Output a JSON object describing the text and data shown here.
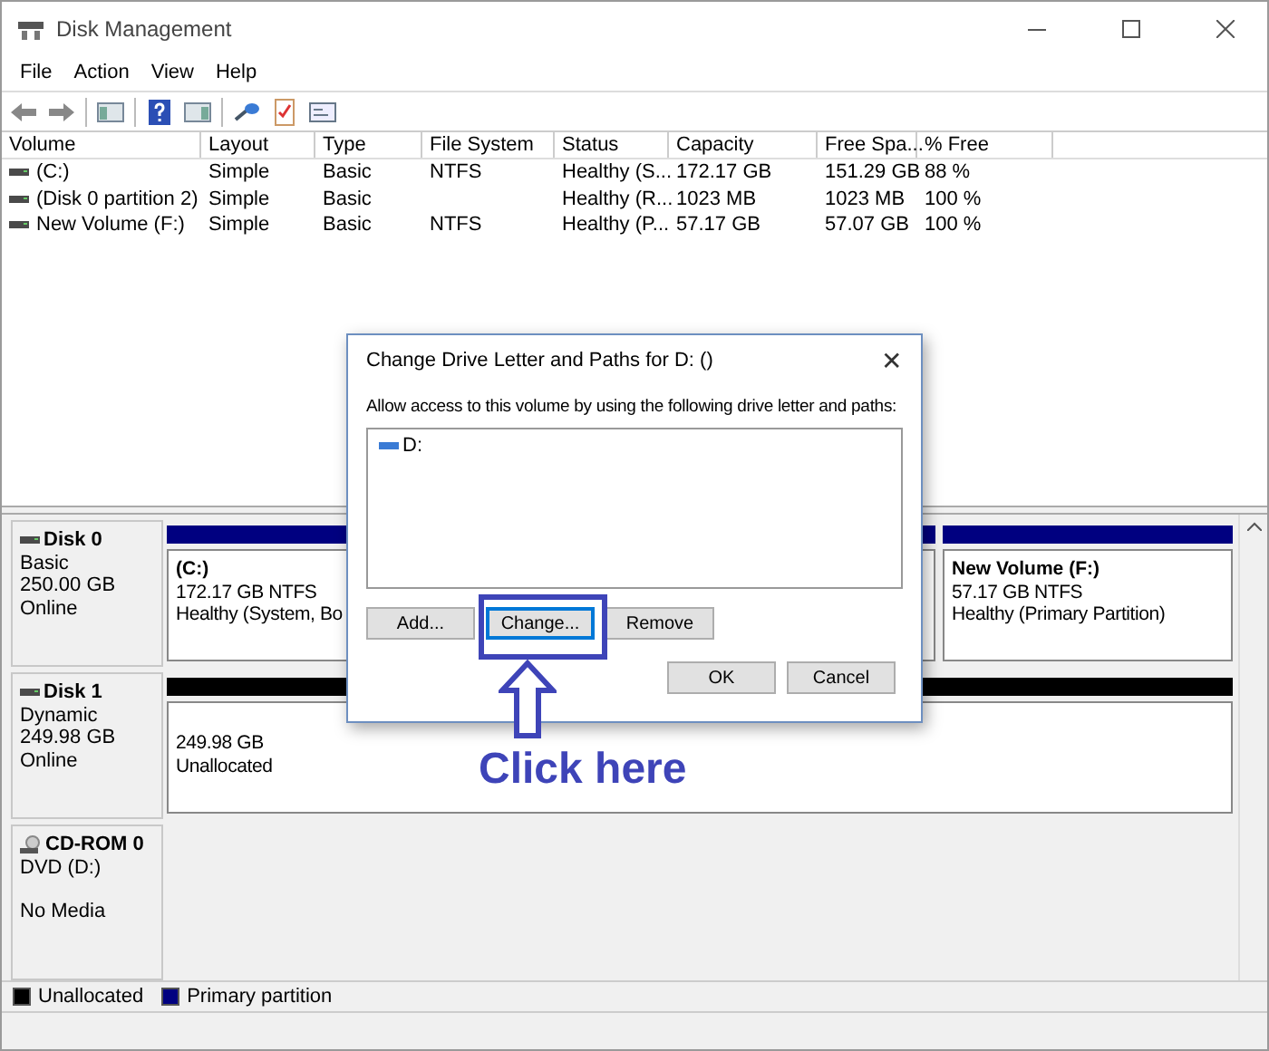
{
  "window": {
    "title": "Disk Management"
  },
  "menu": [
    "File",
    "Action",
    "View",
    "Help"
  ],
  "volumes": {
    "columns": [
      "Volume",
      "Layout",
      "Type",
      "File System",
      "Status",
      "Capacity",
      "Free Spa...",
      "% Free"
    ],
    "rows": [
      [
        "(C:)",
        "Simple",
        "Basic",
        "NTFS",
        "Healthy (S...",
        "172.17 GB",
        "151.29 GB",
        "88 %"
      ],
      [
        "(Disk 0 partition 2)",
        "Simple",
        "Basic",
        "",
        "Healthy (R...",
        "1023 MB",
        "1023 MB",
        "100 %"
      ],
      [
        "New Volume (F:)",
        "Simple",
        "Basic",
        "NTFS",
        "Healthy (P...",
        "57.17 GB",
        "57.07 GB",
        "100 %"
      ]
    ]
  },
  "disks": [
    {
      "kind": "disk",
      "name": "Disk 0",
      "lines": [
        "Basic",
        "250.00 GB",
        "Online"
      ],
      "partitions": [
        {
          "kind": "primary",
          "title": "(C:)",
          "lines": [
            "172.17 GB NTFS",
            "Healthy (System, Bo"
          ]
        },
        {
          "kind": "primary",
          "title": "New Volume  (F:)",
          "lines": [
            "57.17 GB NTFS",
            "Healthy (Primary Partition)"
          ]
        }
      ]
    },
    {
      "kind": "disk",
      "name": "Disk 1",
      "lines": [
        "Dynamic",
        "249.98 GB",
        "Online"
      ],
      "partitions": [
        {
          "kind": "unallocated",
          "lines": [
            "249.98 GB",
            "Unallocated"
          ]
        }
      ]
    },
    {
      "kind": "cdrom",
      "name": "CD-ROM 0",
      "lines": [
        "DVD (D:)",
        "No Media"
      ]
    }
  ],
  "legend": [
    {
      "label": "Unallocated",
      "color": "#000000"
    },
    {
      "label": "Primary partition",
      "color": "#000080"
    }
  ],
  "dialog": {
    "title": "Change Drive Letter and Paths for D: ()",
    "close": "✕",
    "prompt": "Allow access to this volume by using the following drive letter and paths:",
    "paths": [
      "D:"
    ],
    "buttons": [
      {
        "label": "Add...",
        "highlighted": false
      },
      {
        "label": "Change...",
        "highlighted": true
      },
      {
        "label": "Remove",
        "highlighted": false
      }
    ],
    "footer_buttons": [
      "OK",
      "Cancel"
    ]
  },
  "annotation": {
    "text": "Click here"
  }
}
